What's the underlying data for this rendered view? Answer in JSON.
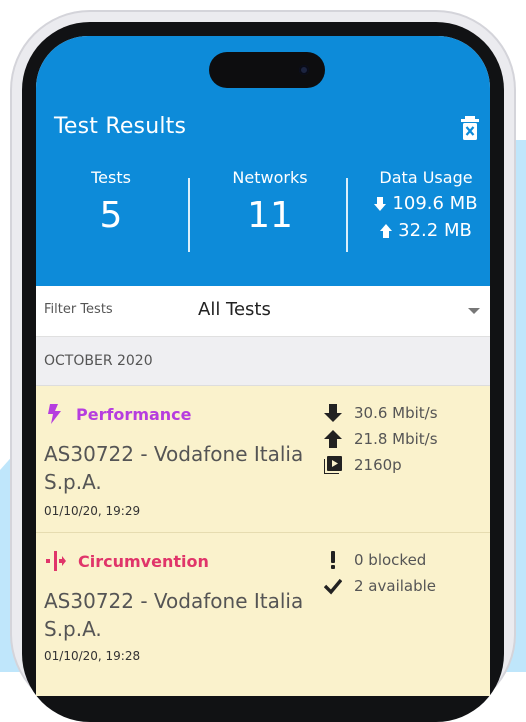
{
  "header": {
    "title": "Test Results",
    "stats": {
      "tests_label": "Tests",
      "tests_value": "5",
      "networks_label": "Networks",
      "networks_value": "11",
      "usage_label": "Data Usage",
      "download": "109.6 MB",
      "upload": "32.2 MB"
    }
  },
  "filter": {
    "label": "Filter Tests",
    "value": "All Tests"
  },
  "month": "OCTOBER 2020",
  "results": [
    {
      "type": "Performance",
      "network": "AS30722 - Vodafone Italia S.p.A.",
      "date": "01/10/20, 19:29",
      "download": "30.6 Mbit/s",
      "upload": "21.8 Mbit/s",
      "video": "2160p"
    },
    {
      "type": "Circumvention",
      "network": "AS30722 - Vodafone Italia S.p.A.",
      "date": "01/10/20, 19:28",
      "blocked": "0 blocked",
      "available": "2 available"
    }
  ],
  "colors": {
    "header_bg": "#0d8bd9",
    "card_bg": "#faf2cc",
    "performance": "#b63ddf",
    "circumvention": "#e0356a"
  }
}
